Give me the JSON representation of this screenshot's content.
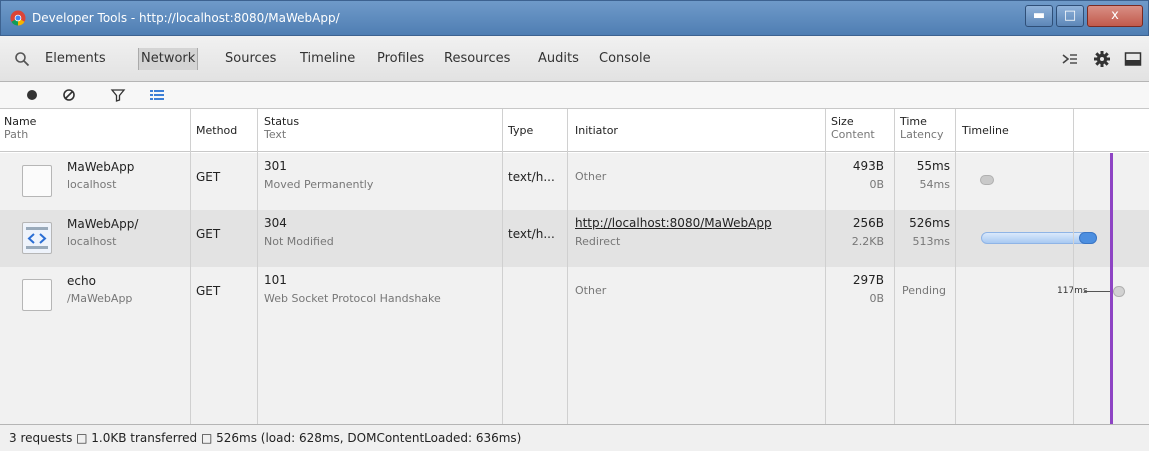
{
  "window": {
    "title": "Developer Tools - http://localhost:8080/MaWebApp/",
    "min_glyph": "▬",
    "max_glyph": "□",
    "close_glyph": "x"
  },
  "tabs": [
    {
      "label": "Elements",
      "selected": false
    },
    {
      "label": "Network",
      "selected": true
    },
    {
      "label": "Sources",
      "selected": false
    },
    {
      "label": "Timeline",
      "selected": false
    },
    {
      "label": "Profiles",
      "selected": false
    },
    {
      "label": "Resources",
      "selected": false
    },
    {
      "label": "Audits",
      "selected": false
    },
    {
      "label": "Console",
      "selected": false
    }
  ],
  "icons": {
    "search": "search-icon",
    "console_drawer": "console-drawer-icon",
    "settings": "gear-icon",
    "dock": "dock-icon",
    "record": "record-icon",
    "clear": "clear-icon",
    "filter": "filter-icon",
    "large_rows": "large-rows-icon"
  },
  "columns": {
    "name": {
      "main": "Name",
      "sub": "Path"
    },
    "method": {
      "main": "Method"
    },
    "status": {
      "main": "Status",
      "sub": "Text"
    },
    "type": {
      "main": "Type"
    },
    "initiator": {
      "main": "Initiator"
    },
    "size": {
      "main": "Size",
      "sub": "Content"
    },
    "time": {
      "main": "Time",
      "sub": "Latency"
    },
    "timeline": {
      "main": "Timeline"
    }
  },
  "rows": [
    {
      "name": "MaWebApp",
      "path": "localhost",
      "method": "GET",
      "status": "301",
      "status_text": "Moved Permanently",
      "type": "text/h...",
      "initiator": "Other",
      "initiator_sub": "",
      "size": "493B",
      "content": "0B",
      "time": "55ms",
      "latency": "54ms"
    },
    {
      "name": "MaWebApp/",
      "path": "localhost",
      "method": "GET",
      "status": "304",
      "status_text": "Not Modified",
      "type": "text/h...",
      "initiator": "http://localhost:8080/MaWebApp",
      "initiator_sub": "Redirect",
      "size": "256B",
      "content": "2.2KB",
      "time": "526ms",
      "latency": "513ms"
    },
    {
      "name": "echo",
      "path": "/MaWebApp",
      "method": "GET",
      "status": "101",
      "status_text": "Web Socket Protocol Handshake",
      "type": "",
      "initiator": "Other",
      "initiator_sub": "",
      "size": "297B",
      "content": "0B",
      "time": "Pending",
      "latency": "",
      "timeline_label": "117ms"
    }
  ],
  "status_bar": "3 requests □ 1.0KB transferred □ 526ms (load: 628ms, DOMContentLoaded: 636ms)",
  "colors": {
    "load_marker": "#8e44c4",
    "timeline_bar": "#6fa3e8"
  }
}
